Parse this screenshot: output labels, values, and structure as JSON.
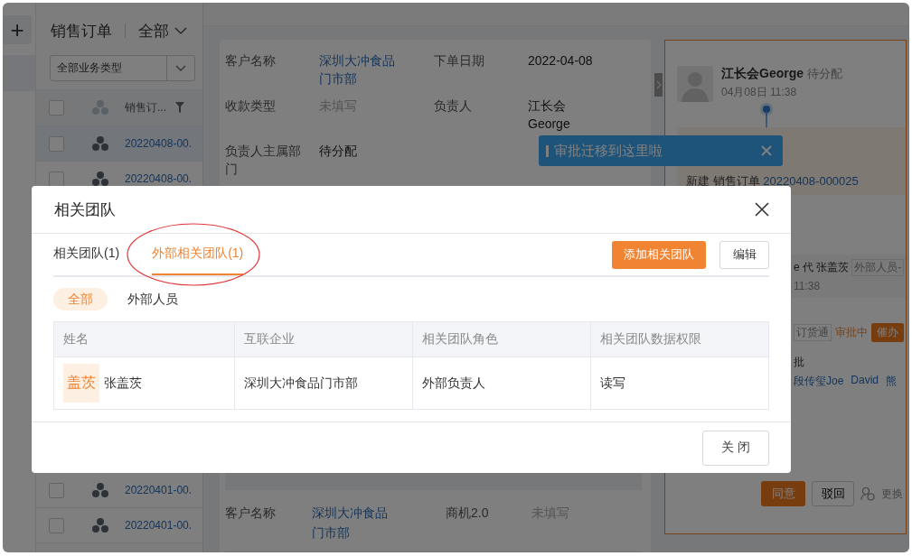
{
  "sidebar": {
    "add_button": "+"
  },
  "list": {
    "title": "销售订单",
    "scope": "全部",
    "type_filter": "全部业务类型",
    "column_header": "销售订...",
    "all_checked": false,
    "rows": [
      {
        "number": "20220408-00.",
        "selected": true,
        "checked": false
      },
      {
        "number": "20220408-00.",
        "selected": false,
        "checked": false
      }
    ],
    "rows_lower": [
      {
        "number": "20220401-00.",
        "selected": false,
        "checked": false
      },
      {
        "number": "20220401-00.",
        "selected": false,
        "checked": false
      }
    ]
  },
  "detail": {
    "fields": [
      {
        "label": "客户名称",
        "value": "深圳大冲食品门市部",
        "kind": "link"
      },
      {
        "label": "下单日期",
        "value": "2022-04-08",
        "kind": "text"
      },
      {
        "label": "收款类型",
        "value": "未填写",
        "kind": "empty"
      },
      {
        "label": "负责人",
        "value": "江长会George",
        "kind": "text"
      },
      {
        "label": "负责人主属部门",
        "value": "待分配",
        "kind": "text"
      }
    ],
    "section_fields": [
      {
        "label": "客户名称",
        "value": "深圳大冲食品门市部",
        "kind": "link"
      },
      {
        "label": "商机2.0",
        "value": "未填写",
        "kind": "empty"
      }
    ]
  },
  "approval": {
    "user": "江长会George",
    "status": "待分配",
    "time": "04月08日 11:38",
    "card_action": "新建 销售订单",
    "card_number": "20220408-000025",
    "step_actor": "e 代 张盖茨",
    "step_tag": "外部人员-",
    "step_time": "11:38",
    "source_tag": "订货通",
    "state": "审批中",
    "remind_button": "催办",
    "stage": "批",
    "approvers": [
      "段传玺Joe",
      "David",
      "熊"
    ],
    "agree_button": "同意",
    "reject_button": "驳回",
    "transfer_link": "更换"
  },
  "tooltip": {
    "text": "审批迁移到这里啦"
  },
  "dialog": {
    "title": "相关团队",
    "tabs": [
      {
        "label": "相关团队(1)",
        "selected": false,
        "circled": false
      },
      {
        "label": "外部相关团队(1)",
        "selected": true,
        "circled": true
      }
    ],
    "add_button": "添加相关团队",
    "edit_button": "编辑",
    "filters": [
      {
        "label": "全部",
        "selected": true
      },
      {
        "label": "外部人员",
        "selected": false
      }
    ],
    "table": {
      "columns": [
        "姓名",
        "互联企业",
        "相关团队角色",
        "相关团队数据权限"
      ],
      "rows": [
        {
          "avatar": "盖茨",
          "name": "张盖茨",
          "company": "深圳大冲食品门市部",
          "role": "外部负责人",
          "permission": "读写"
        }
      ]
    },
    "close_button": "关 闭"
  }
}
